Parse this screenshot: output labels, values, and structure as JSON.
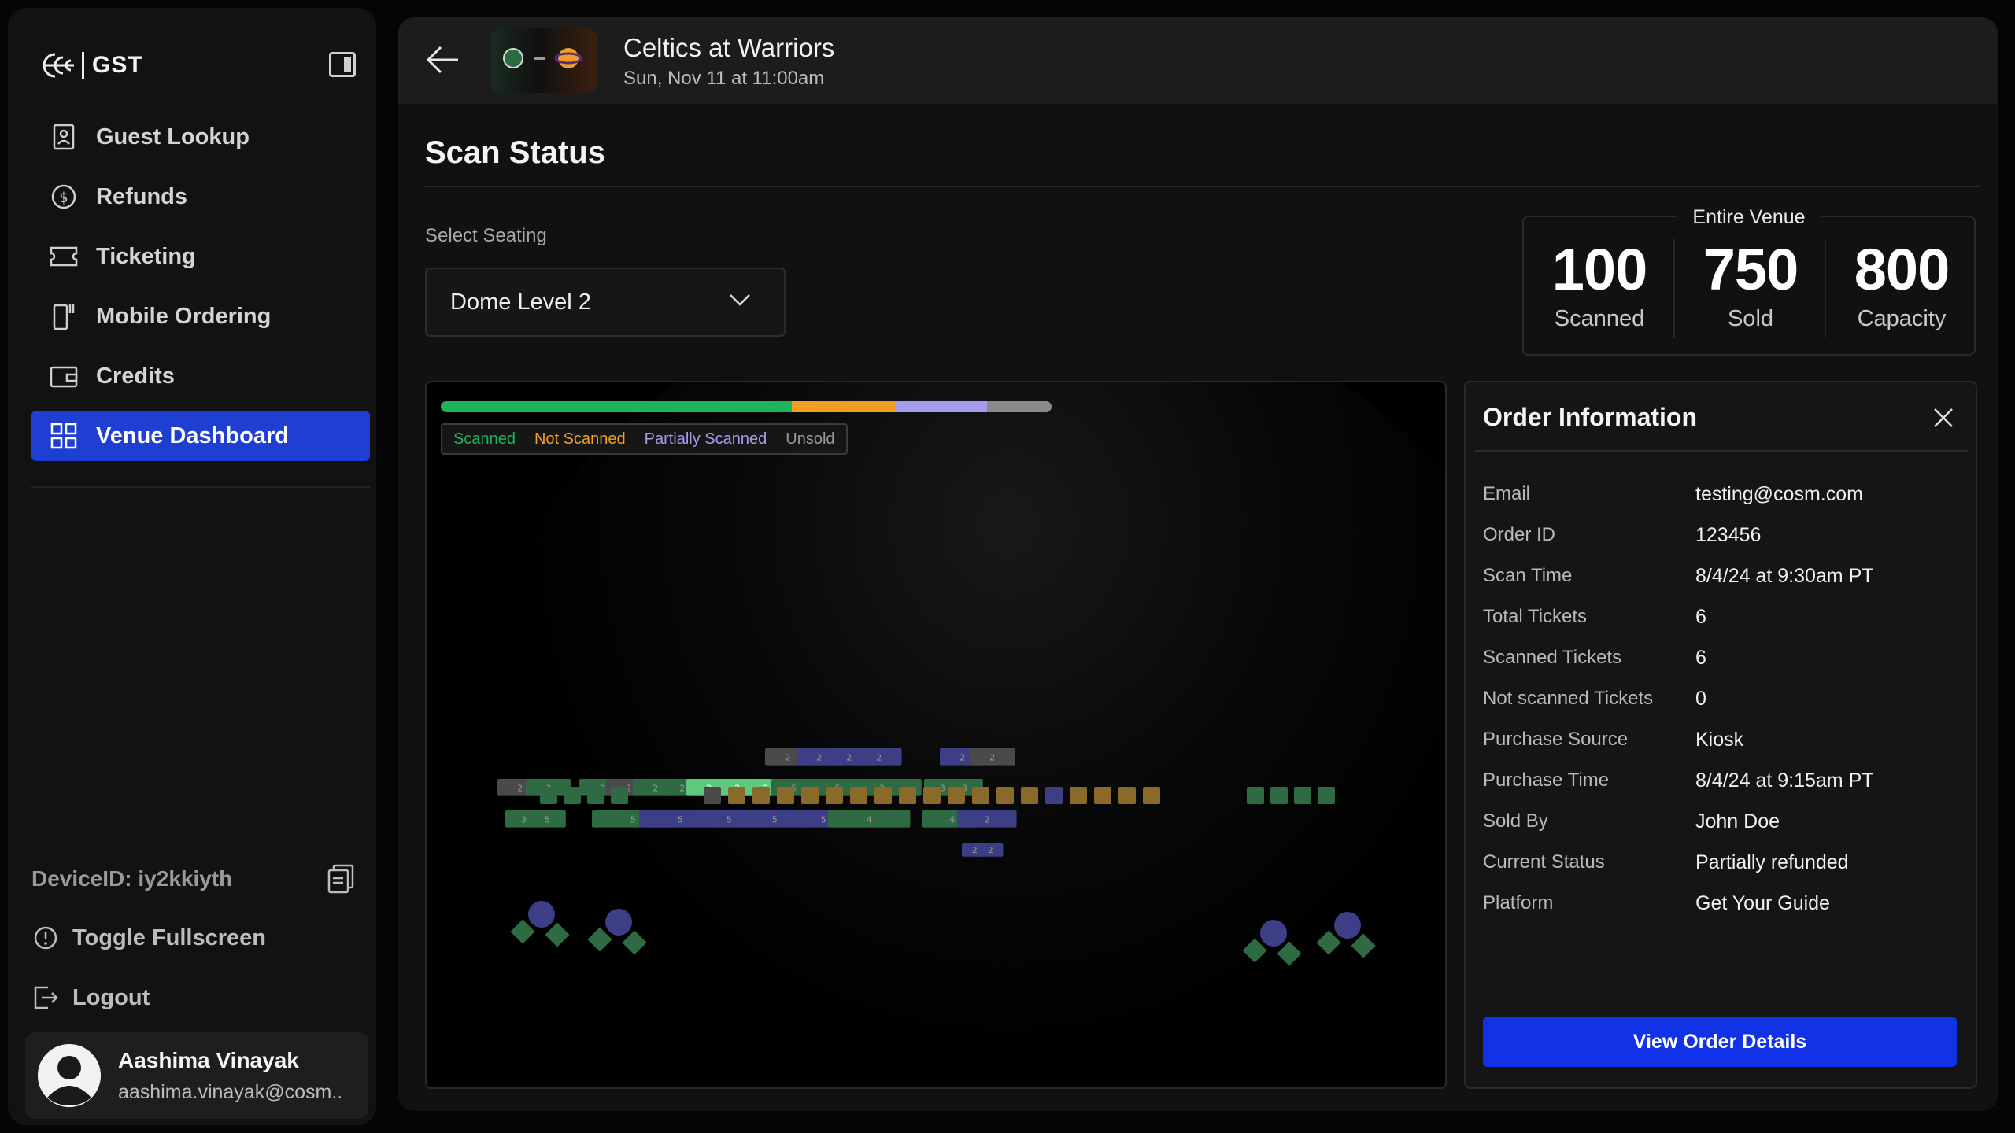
{
  "sidebar": {
    "brand": "GST",
    "nav": [
      {
        "label": "Guest Lookup",
        "icon": "guest-lookup-icon"
      },
      {
        "label": "Refunds",
        "icon": "refund-dollar-icon"
      },
      {
        "label": "Ticketing",
        "icon": "ticket-icon"
      },
      {
        "label": "Mobile Ordering",
        "icon": "mobile-ordering-icon"
      },
      {
        "label": "Credits",
        "icon": "wallet-icon"
      },
      {
        "label": "Venue Dashboard",
        "icon": "grid-icon",
        "active": true
      }
    ],
    "device_id": "DeviceID: iy2kkiyth",
    "toggle_fullscreen": "Toggle Fullscreen",
    "logout": "Logout",
    "user": {
      "name": "Aashima Vinayak",
      "email": "aashima.vinayak@cosm.."
    }
  },
  "header": {
    "event_title": "Celtics at Warriors",
    "event_date": "Sun, Nov 11 at 11:00am"
  },
  "page": {
    "title": "Scan Status",
    "select_label": "Select Seating",
    "select_value": "Dome Level 2"
  },
  "stats": {
    "legend": "Entire Venue",
    "scanned_value": "100",
    "scanned_label": "Scanned",
    "sold_value": "750",
    "sold_label": "Sold",
    "capacity_value": "800",
    "capacity_label": "Capacity"
  },
  "map": {
    "progress": [
      {
        "label": "Scanned",
        "fraction": 0.575,
        "color": "#1fb35e"
      },
      {
        "label": "Not Scanned",
        "fraction": 0.17,
        "color": "#f0a020"
      },
      {
        "label": "Partially Scanned",
        "fraction": 0.15,
        "color": "#a69cf0"
      },
      {
        "label": "Unsold",
        "fraction": 0.105,
        "color": "#8a8a8a"
      }
    ],
    "legend": {
      "scanned": "Scanned",
      "not_scanned": "Not Scanned",
      "partially_scanned": "Partially Scanned",
      "unsold": "Unsold"
    },
    "colors": {
      "scanned": "#2e6b42",
      "scanned_highlight": "#5fc97b",
      "not_scanned": "#8a6a2a",
      "partial": "#3d3f86",
      "unsold": "#4a4a4a"
    },
    "sections": [
      {
        "label": "2",
        "status": "unsold"
      },
      {
        "label": "2",
        "status": "partial"
      },
      {
        "label": "2",
        "status": "partial"
      },
      {
        "label": "2",
        "status": "partial"
      },
      {
        "label": "2",
        "status": "partial"
      },
      {
        "label": "2",
        "status": "unsold"
      },
      {
        "label": "2",
        "status": "unsold"
      },
      {
        "label": "3",
        "status": "scanned"
      },
      {
        "label": "3",
        "status": "scanned"
      },
      {
        "label": "2",
        "status": "unsold"
      },
      {
        "label": "2",
        "status": "scanned"
      },
      {
        "label": "2",
        "status": "scanned"
      },
      {
        "label": "2",
        "status": "highlight"
      },
      {
        "label": "2",
        "status": "highlight"
      },
      {
        "label": "2",
        "status": "highlight"
      },
      {
        "label": "5",
        "status": "scanned"
      },
      {
        "label": "5",
        "status": "scanned"
      },
      {
        "label": "3",
        "status": "scanned"
      },
      {
        "label": "3",
        "status": "scanned"
      },
      {
        "label": "3",
        "status": "scanned"
      },
      {
        "label": "3",
        "status": "scanned"
      },
      {
        "label": "5",
        "status": "scanned"
      },
      {
        "label": "5",
        "status": "scanned"
      },
      {
        "label": "5",
        "status": "partial"
      },
      {
        "label": "5",
        "status": "partial"
      },
      {
        "label": "5",
        "status": "partial"
      },
      {
        "label": "5",
        "status": "partial"
      },
      {
        "label": "4",
        "status": "scanned"
      },
      {
        "label": "4",
        "status": "scanned"
      },
      {
        "label": "2",
        "status": "partial"
      },
      {
        "label": "2",
        "status": "partial"
      },
      {
        "label": "2",
        "status": "partial"
      },
      {
        "label": "2",
        "status": "partial"
      }
    ]
  },
  "order": {
    "title": "Order Information",
    "rows": [
      {
        "key": "Email",
        "value": "testing@cosm.com"
      },
      {
        "key": "Order ID",
        "value": "123456"
      },
      {
        "key": "Scan Time",
        "value": "8/4/24 at 9:30am PT"
      },
      {
        "key": "Total Tickets",
        "value": "6"
      },
      {
        "key": "Scanned Tickets",
        "value": "6"
      },
      {
        "key": "Not scanned Tickets",
        "value": "0"
      },
      {
        "key": "Purchase Source",
        "value": "Kiosk"
      },
      {
        "key": "Purchase Time",
        "value": "8/4/24 at 9:15am PT"
      },
      {
        "key": "Sold By",
        "value": "John Doe"
      },
      {
        "key": "Current Status",
        "value": "Partially refunded"
      },
      {
        "key": "Platform",
        "value": "Get Your Guide"
      }
    ],
    "button": "View Order Details"
  }
}
